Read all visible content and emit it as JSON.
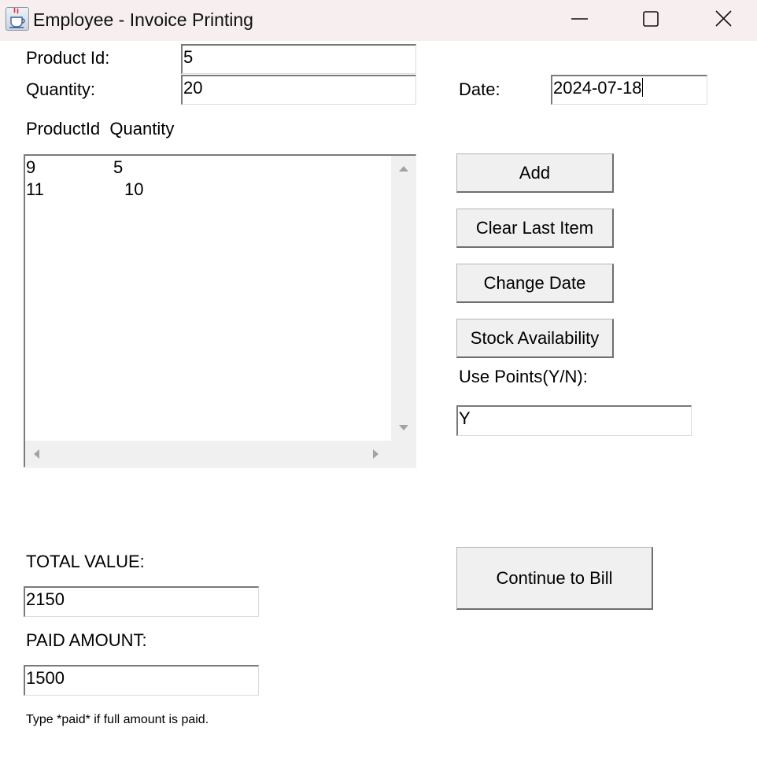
{
  "window": {
    "title": "Employee - Invoice Printing",
    "app_icon": "java-coffee-cup-icon",
    "controls": [
      "minimize-icon",
      "maximize-icon",
      "close-icon"
    ]
  },
  "form": {
    "product_id_label": "Product Id:",
    "product_id_value": "5",
    "quantity_label": "Quantity:",
    "quantity_value": "20",
    "date_label": "Date:",
    "date_value": "2024-07-18",
    "list_header": "ProductId  Quantity",
    "items": [
      {
        "product_id": "9",
        "quantity": "5"
      },
      {
        "product_id": "11",
        "quantity": "10"
      }
    ],
    "use_points_label": "Use Points(Y/N):",
    "use_points_value": "Y",
    "total_value_label": "TOTAL VALUE:",
    "total_value": "2150",
    "paid_amount_label": "PAID AMOUNT:",
    "paid_amount": "1500",
    "paid_note": "Type *paid* if full amount is paid."
  },
  "buttons": {
    "add": "Add",
    "clear_last": "Clear Last Item",
    "change_date": "Change Date",
    "stock": "Stock Availability",
    "continue": "Continue to Bill"
  },
  "colors": {
    "titlebar_bg": "#f6eeef",
    "button_bg": "#f0f0f0",
    "scroll_bg": "#f0f0f0"
  }
}
